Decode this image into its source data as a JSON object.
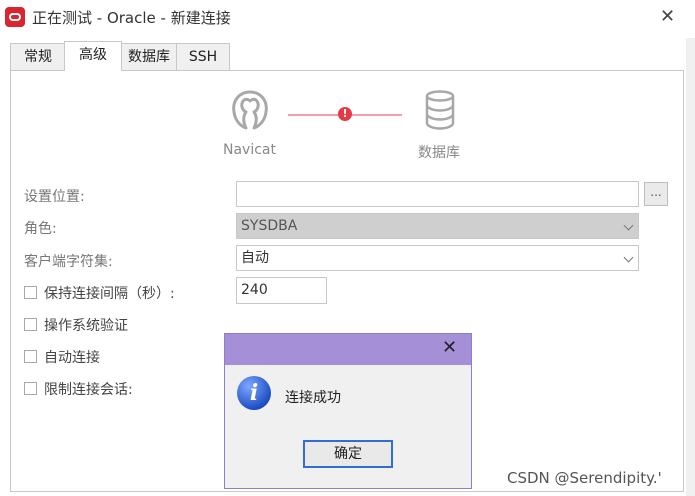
{
  "window": {
    "title": "正在测试 - Oracle - 新建连接",
    "close_symbol": "✕"
  },
  "tabs": [
    {
      "label": "常规",
      "active": false
    },
    {
      "label": "高级",
      "active": true
    },
    {
      "label": "数据库",
      "active": false
    },
    {
      "label": "SSH",
      "active": false
    }
  ],
  "diagram": {
    "left_label": "Navicat",
    "right_label": "数据库",
    "status_icon": "error-icon",
    "status_symbol": "!"
  },
  "form": {
    "settings_location": {
      "label": "设置位置:",
      "value": "",
      "browse_label": "..."
    },
    "role": {
      "label": "角色:",
      "value": "SYSDBA"
    },
    "client_charset": {
      "label": "客户端字符集:",
      "value": "自动"
    },
    "keepalive": {
      "label": "保持连接间隔（秒）:",
      "value": "240",
      "checked": false
    },
    "os_auth": {
      "label": "操作系统验证",
      "checked": false
    },
    "auto_connect": {
      "label": "自动连接",
      "checked": false
    },
    "limit_sessions": {
      "label": "限制连接会话:",
      "checked": false
    }
  },
  "dialog": {
    "close_symbol": "✕",
    "message": "连接成功",
    "ok_label": "确定",
    "icon": "info-icon",
    "icon_symbol": "i"
  },
  "watermark": "CSDN @Serendipity.'",
  "colors": {
    "dialog_titlebar": "#a58fd6",
    "error": "#e63946",
    "app_icon": "#d9262e"
  }
}
